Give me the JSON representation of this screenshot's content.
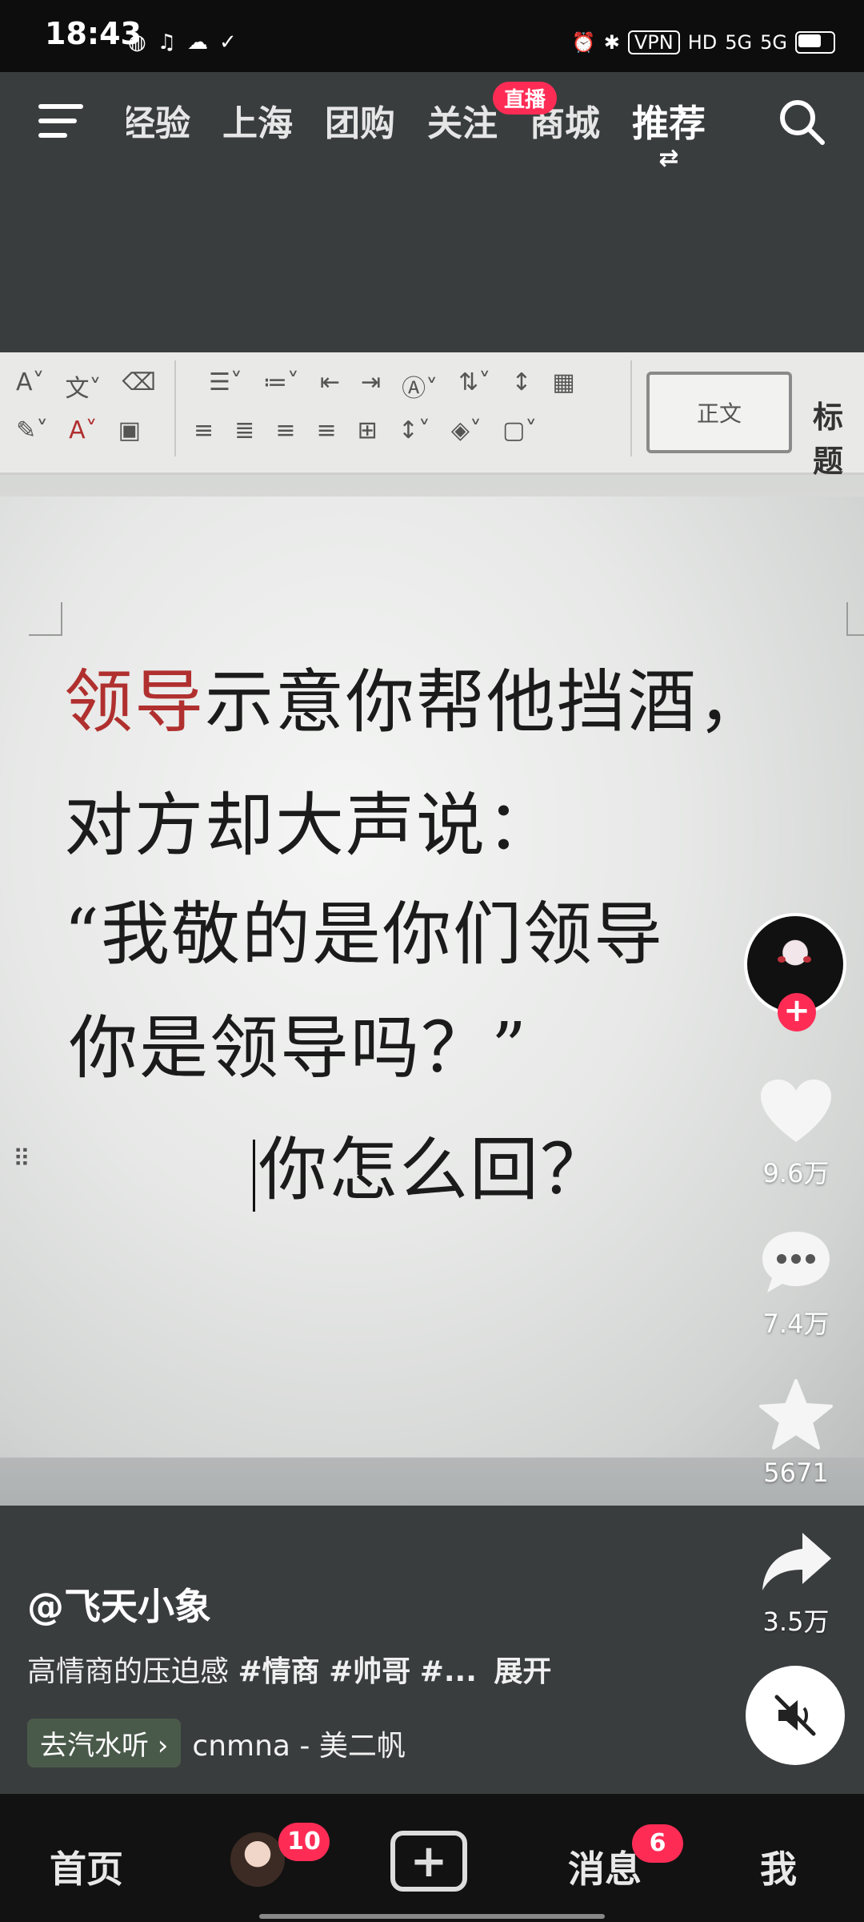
{
  "status_bar": {
    "time": "18:43",
    "vpn": "VPN",
    "network": "5G"
  },
  "top_nav": {
    "tabs": [
      "经验",
      "上海",
      "团购",
      "关注",
      "商城",
      "推荐"
    ],
    "live_badge": "直播",
    "active_tab": "推荐"
  },
  "document": {
    "style_normal": "正文",
    "style_heading": "标题",
    "line1_red": "领导",
    "line1_rest": "示意你帮他挡酒，",
    "line2": "对方却大声说：",
    "line3": "“我敬的是你们领导",
    "line4": "你是领导吗？”",
    "line5": "你怎么回？"
  },
  "actions": {
    "likes": "9.6万",
    "comments": "7.4万",
    "favorites": "5671",
    "shares": "3.5万"
  },
  "caption": {
    "author": "@飞天小象",
    "text": "高情商的压迫感",
    "tag1": "#情商",
    "tag2": "#帅哥",
    "tag3": "#...",
    "expand": "展开"
  },
  "music": {
    "tag": "去汽水听 ›",
    "name": "cnmna - 美二帆"
  },
  "bottom_nav": {
    "home": "首页",
    "friends_badge": "10",
    "messages": "消息",
    "messages_badge": "6",
    "me": "我"
  },
  "colors": {
    "accent": "#fe2c55",
    "doc_red": "#b0302f"
  }
}
